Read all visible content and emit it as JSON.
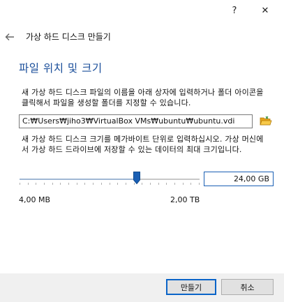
{
  "window": {
    "help_label": "?",
    "close_label": "✕"
  },
  "nav": {
    "back_icon": "arrow-left-icon",
    "title": "가상 하드 디스크 만들기"
  },
  "section": {
    "heading": "파일 위치 및 크기",
    "location_description": "새 가상 하드 디스크 파일의 이름을 아래 상자에 입력하거나 폴더 아이콘을 클릭해서 파일을 생성할 폴더를 지정할 수 있습니다.",
    "size_description": "새 가상 하드 디스크 크기를 메가바이트 단위로 입력하십시오. 가상 머신에서 가상 하드 드라이브에 저장할 수 있는 데이터의 최대 크기입니다."
  },
  "file_path": {
    "value": "C:₩Users₩jiho3₩VirtualBox VMs₩ubuntu₩ubuntu.vdi",
    "folder_icon": "folder-open-icon"
  },
  "size": {
    "value": "24,00 GB",
    "slider_fraction": 0.65,
    "min_label": "4,00 MB",
    "max_label": "2,00 TB",
    "tick_count": 23
  },
  "buttons": {
    "create": "만들기",
    "cancel": "취소"
  },
  "colors": {
    "heading": "#1a4e9a",
    "accent": "#0a64c8",
    "folder": "#e8a317",
    "thumb": "#1a5fb4"
  }
}
